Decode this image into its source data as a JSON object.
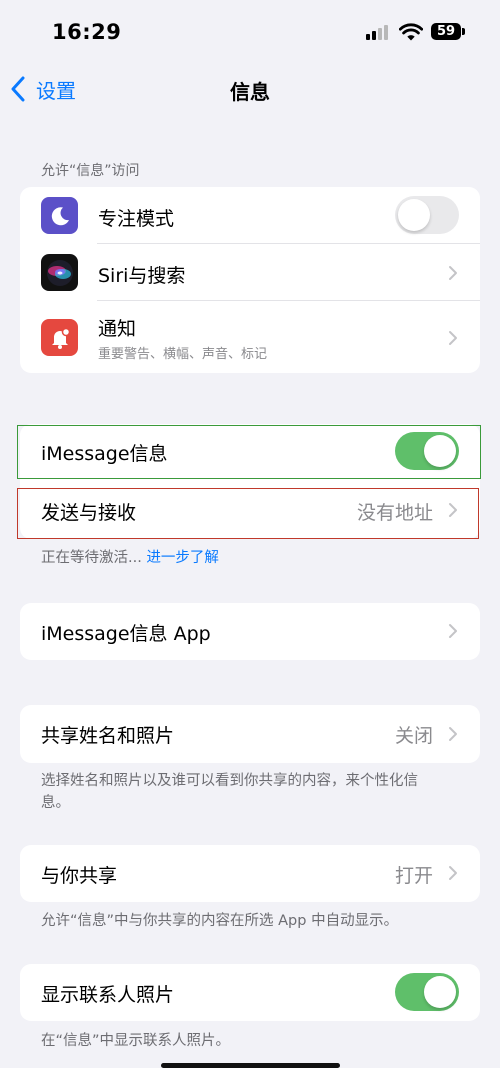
{
  "status": {
    "time": "16:29",
    "battery": "59"
  },
  "nav": {
    "back_label": "设置",
    "title": "信息"
  },
  "access_section": {
    "header": "允许“信息”访问",
    "items": [
      {
        "label": "专注模式",
        "icon": "moon-icon",
        "toggle": "off"
      },
      {
        "label": "Siri与搜索",
        "icon": "siri-icon"
      },
      {
        "label": "通知",
        "sublabel": "重要警告、横幅、声音、标记",
        "icon": "bell-icon"
      }
    ]
  },
  "imessage": {
    "label": "iMessage信息",
    "toggle": "on"
  },
  "send_receive": {
    "label": "发送与接收",
    "value": "没有地址"
  },
  "activation": {
    "text": "正在等待激活... ",
    "link": "进一步了解"
  },
  "imessage_app": {
    "label": "iMessage信息 App"
  },
  "share_name": {
    "label": "共享姓名和照片",
    "value": "关闭",
    "footer": "选择姓名和照片以及谁可以看到你共享的内容，来个性化信息。"
  },
  "shared_with_you": {
    "label": "与你共享",
    "value": "打开",
    "footer": "允许“信息”中与你共享的内容在所选 App 中自动显示。"
  },
  "contact_photos": {
    "label": "显示联系人照片",
    "toggle": "on",
    "footer": "在“信息”中显示联系人照片。"
  },
  "colors": {
    "accent": "#0a7aff",
    "toggle_on": "#5fbf6a",
    "highlight_green": "#3a9a3a",
    "highlight_red": "#c0392b",
    "moon_bg": "#5b50c8",
    "bell_bg": "#e5483f"
  }
}
